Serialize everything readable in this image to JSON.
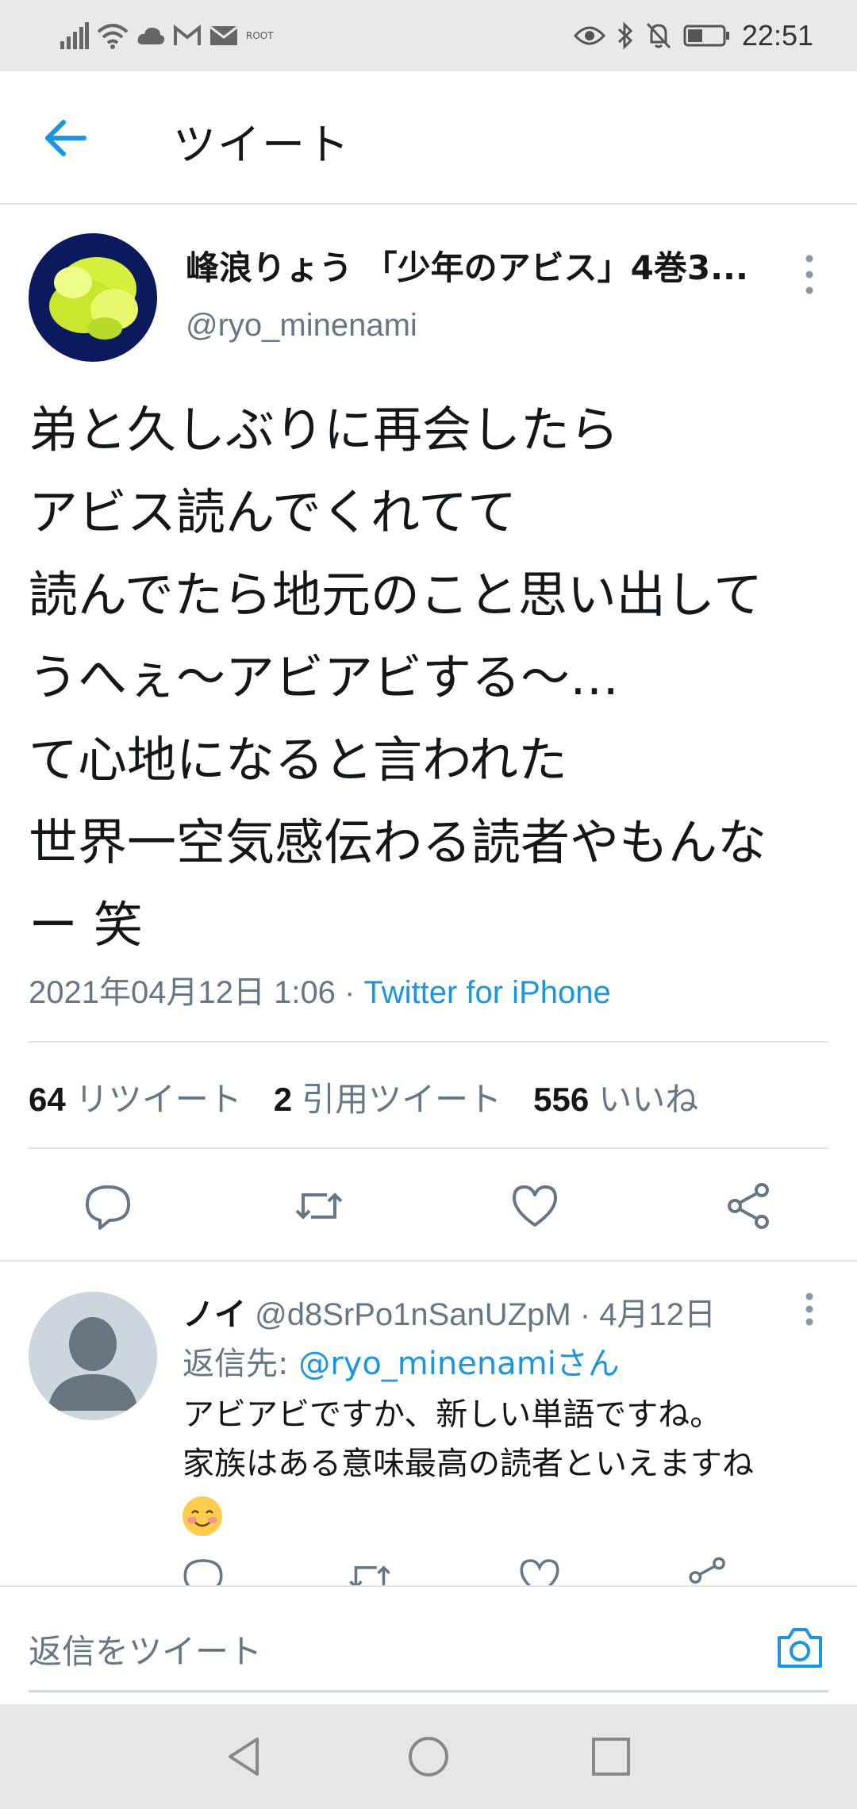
{
  "status_bar": {
    "time": "22:51",
    "tiny_label": "ROOT"
  },
  "header": {
    "title": "ツイート"
  },
  "tweet": {
    "author_name": "峰浪りょう 「少年のアビス」4巻3...",
    "author_handle": "@ryo_minenami",
    "lines": [
      "弟と久しぶりに再会したら",
      "アビス読んでくれてて",
      "読んでたら地元のこと思い出して",
      "うへぇ～アビアビする～…",
      "て心地になると言われた",
      "世界一空気感伝わる読者やもんな",
      "ー 笑"
    ],
    "timestamp": "2021年04月12日 1:06 · ",
    "source": "Twitter for iPhone",
    "retweets_count": "64",
    "retweets_label": "リツイート",
    "quotes_count": "2",
    "quotes_label": "引用ツイート",
    "likes_count": "556",
    "likes_label": "いいね"
  },
  "reply": {
    "name": "ノイ",
    "handle_date": " @d8SrPo1nSanUZpM · 4月12日",
    "reply_to_prefix": "返信先: ",
    "reply_to_mention": "@ryo_minenamiさん",
    "text_line1": "アビアビですか、新しい単語ですね。",
    "text_line2": "家族はある意味最高の読者といえますね"
  },
  "compose": {
    "placeholder": "返信をツイート"
  },
  "colors": {
    "accent": "#1b95e0",
    "secondary_text": "#657786",
    "divider": "#e1e5e8"
  },
  "icons": {
    "back": "arrow-left-icon",
    "more": "more-vertical-icon",
    "reply": "reply-icon",
    "retweet": "retweet-icon",
    "like": "heart-icon",
    "share": "share-icon",
    "camera": "camera-icon"
  }
}
